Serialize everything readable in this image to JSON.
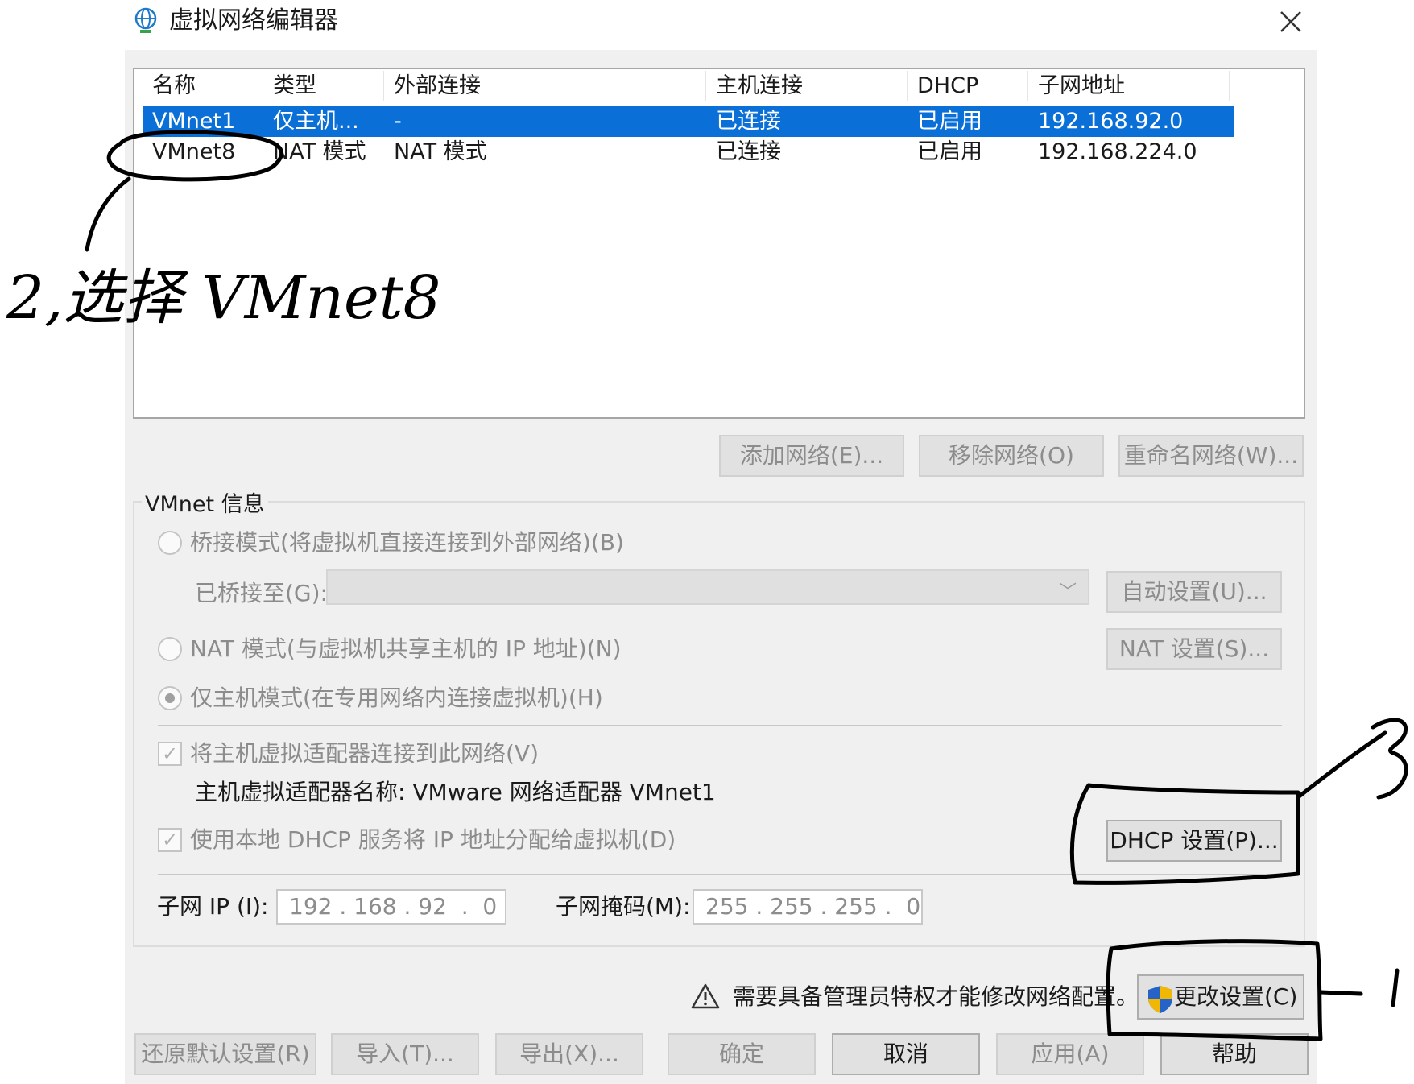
{
  "window": {
    "title": "虚拟网络编辑器",
    "icon": "globe-network-icon",
    "close_icon": "close-icon"
  },
  "table": {
    "columns": [
      "名称",
      "类型",
      "外部连接",
      "主机连接",
      "DHCP",
      "子网地址"
    ],
    "rows": [
      {
        "name": "VMnet1",
        "type": "仅主机...",
        "external": "-",
        "host": "已连接",
        "dhcp": "已启用",
        "subnet": "192.168.92.0",
        "selected": true
      },
      {
        "name": "VMnet8",
        "type": "NAT 模式",
        "external": "NAT 模式",
        "host": "已连接",
        "dhcp": "已启用",
        "subnet": "192.168.224.0",
        "selected": false
      }
    ]
  },
  "network_buttons": {
    "add": "添加网络(E)...",
    "remove": "移除网络(O)",
    "rename": "重命名网络(W)..."
  },
  "vmnet_info": {
    "group_label": "VMnet 信息",
    "bridge_radio": "桥接模式(将虚拟机直接连接到外部网络)(B)",
    "bridged_to_label": "已桥接至(G):",
    "auto_settings": "自动设置(U)...",
    "nat_radio": "NAT 模式(与虚拟机共享主机的 IP 地址)(N)",
    "nat_settings": "NAT 设置(S)...",
    "host_only_radio": "仅主机模式(在专用网络内连接虚拟机)(H)",
    "connect_adapter_check": "将主机虚拟适配器连接到此网络(V)",
    "adapter_name": "主机虚拟适配器名称: VMware 网络适配器 VMnet1",
    "dhcp_check": "使用本地 DHCP 服务将 IP 地址分配给虚拟机(D)",
    "dhcp_settings": "DHCP 设置(P)...",
    "subnet_ip_label": "子网 IP (I):",
    "subnet_ip_value": "192 . 168 . 92  .  0",
    "subnet_mask_label": "子网掩码(M):",
    "subnet_mask_value": "255 . 255 . 255 .  0"
  },
  "admin_notice": {
    "icon": "warning-icon",
    "text": "需要具备管理员特权才能修改网络配置。",
    "change_settings_icon": "uac-shield-icon",
    "change_settings": "更改设置(C)"
  },
  "footer_buttons": {
    "restore": "还原默认设置(R)",
    "import": "导入(T)...",
    "export": "导出(X)...",
    "ok": "确定",
    "cancel": "取消",
    "apply": "应用(A)",
    "help": "帮助"
  },
  "annotations": {
    "step2_text": "2,选择 VMnet8",
    "step1_text": "1",
    "step3_text": "3",
    "ink_color": "#000000"
  },
  "colors": {
    "selection": "#0a6fd6",
    "dialog_bg": "#f0f0f0"
  }
}
